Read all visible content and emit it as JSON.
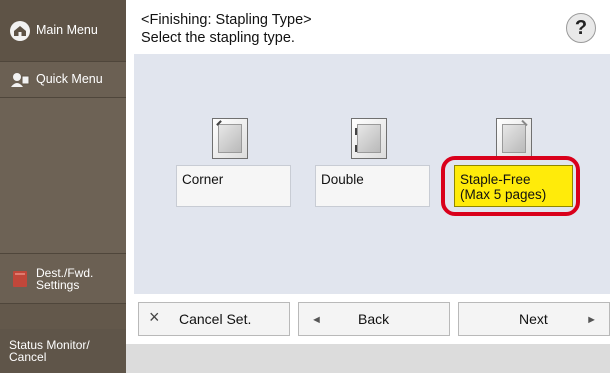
{
  "sidebar": {
    "main_menu": "Main Menu",
    "quick_menu": "Quick Menu",
    "dest_fwd": [
      "Dest./Fwd.",
      "Settings"
    ],
    "status_monitor": [
      "Status Monitor/",
      "Cancel"
    ]
  },
  "header": {
    "title": "<Finishing: Stapling Type>",
    "subtitle": "Select the stapling type.",
    "help": "?"
  },
  "options": {
    "corner": "Corner",
    "double": "Double",
    "staple_free": [
      "Staple-Free",
      "(Max 5 pages)"
    ],
    "selected": "staple_free"
  },
  "buttons": {
    "cancel": "Cancel Set.",
    "cancel_icon": "×",
    "back": "Back",
    "back_icon": "◄",
    "next": "Next",
    "next_icon": "►"
  },
  "colors": {
    "sidebar": "#63584b",
    "panel": "#e1e5ee",
    "selected_fill": "#ffeb0a",
    "selected_ring": "#d9001b"
  }
}
